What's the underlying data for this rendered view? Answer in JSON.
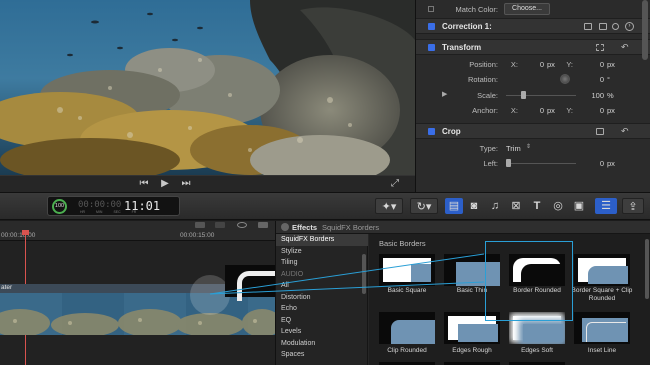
{
  "inspector": {
    "match_color": {
      "label": "Match Color:",
      "button": "Choose..."
    },
    "correction": {
      "title": "Correction 1:"
    },
    "transform": {
      "title": "Transform",
      "position": {
        "label": "Position:",
        "x_label": "X:",
        "x_value": "0",
        "x_unit": "px",
        "y_label": "Y:",
        "y_value": "0",
        "y_unit": "px"
      },
      "rotation": {
        "label": "Rotation:",
        "value": "0",
        "unit": "°"
      },
      "scale": {
        "label": "Scale:",
        "value": "100",
        "unit": "%"
      },
      "anchor": {
        "label": "Anchor:",
        "x_label": "X:",
        "x_value": "0",
        "x_unit": "px",
        "y_label": "Y:",
        "y_value": "0",
        "y_unit": "px"
      }
    },
    "crop": {
      "title": "Crop",
      "type": {
        "label": "Type:",
        "value": "Trim"
      },
      "left": {
        "label": "Left:",
        "value": "0",
        "unit": "px"
      }
    }
  },
  "toolbar": {
    "progress": "100",
    "timecode": "11:01",
    "timecode_prefix": "00:00:00",
    "timecode_units": [
      "HR",
      "MIN",
      "SEC",
      "FR"
    ]
  },
  "timeline": {
    "ruler_labels": [
      "00:00:10:00",
      "00:00:15:00"
    ],
    "track_label": "ater"
  },
  "effects": {
    "header": "Effects",
    "breadcrumb": "SquidFX Borders",
    "categories": [
      "SquidFX Borders",
      "Stylize",
      "Tiling",
      "AUDIO",
      "All",
      "Distortion",
      "Echo",
      "EQ",
      "Levels",
      "Modulation",
      "Spaces"
    ],
    "group_title": "Basic Borders",
    "items": [
      {
        "name": "Basic Square"
      },
      {
        "name": "Basic Thin"
      },
      {
        "name": "Border Rounded"
      },
      {
        "name": "Border Square + Clip Rounded"
      },
      {
        "name": "Clip Rounded"
      },
      {
        "name": "Edges Rough"
      },
      {
        "name": "Edges Soft"
      },
      {
        "name": "Inset Line"
      }
    ]
  },
  "colors": {
    "accent": "#3a6ee8",
    "selection": "#2a9fd6",
    "playhead": "#d9534f"
  }
}
